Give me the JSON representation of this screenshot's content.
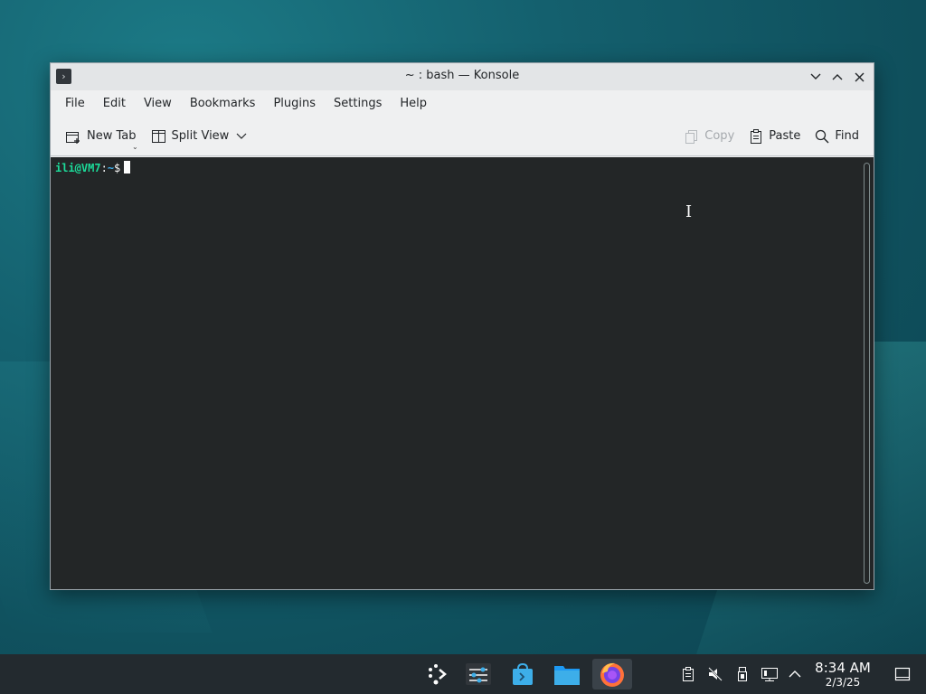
{
  "window": {
    "title": "~ : bash — Konsole",
    "app_icon": "terminal-icon"
  },
  "menu": [
    "File",
    "Edit",
    "View",
    "Bookmarks",
    "Plugins",
    "Settings",
    "Help"
  ],
  "toolbar": {
    "new_tab": "New Tab",
    "split_view": "Split View",
    "copy": "Copy",
    "paste": "Paste",
    "find": "Find"
  },
  "terminal": {
    "user_host": "ili@VM7",
    "separator": ":",
    "path": "~",
    "sign": "$"
  },
  "taskbar": {
    "apps": [
      "application-launcher-icon",
      "system-settings-icon",
      "discover-store-icon",
      "dolphin-files-icon",
      "firefox-icon"
    ],
    "tray": [
      "clipboard-icon",
      "volume-muted-icon",
      "usb-device-icon",
      "network-icon",
      "tray-expand-icon"
    ],
    "clock_time": "8:34 AM",
    "clock_date": "2/3/25"
  },
  "colors": {
    "prompt_user": "#1cdc9a",
    "prompt_path": "#3daee9",
    "terminal_bg": "#232627",
    "taskbar_bg": "#232a2f"
  }
}
